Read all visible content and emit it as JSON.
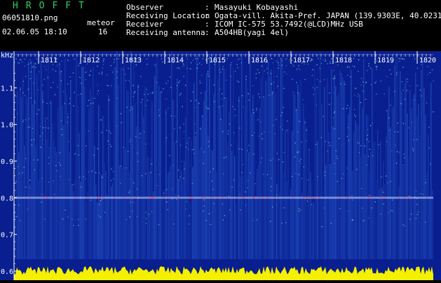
{
  "header": {
    "app_title": "HROFFT",
    "file_name": "06051810.png",
    "datetime": "02.06.05 18:10",
    "meteor_label": "meteor",
    "meteor_count": "16"
  },
  "meta": [
    {
      "key": "Observer",
      "value": "Masayuki Kobayashi"
    },
    {
      "key": "Receiving Location",
      "value": "Ogata-vill. Akita-Pref. JAPAN (139.9303E, 40.0231N)"
    },
    {
      "key": "Receiver",
      "value": "ICOM IC-575 53.7492(@LCD)MHz USB"
    },
    {
      "key": "Receiving antenna",
      "value": "A504HB(yagi 4el)"
    }
  ],
  "meta_colon": ":",
  "spectrogram": {
    "y_unit": "kHz",
    "y_ticks": [
      "1.1",
      "1.0",
      "0.9",
      "0.8",
      "0.7",
      "0.6"
    ],
    "y_tick_values": [
      1.1,
      1.0,
      0.9,
      0.8,
      0.7,
      0.6
    ],
    "y_range": [
      0.575,
      1.2
    ],
    "time_labels": [
      "1811",
      "1812",
      "1813",
      "1814",
      "1815",
      "1816",
      "1817",
      "1818",
      "1819",
      "1820"
    ],
    "carrier_freq_khz": 0.8,
    "colors": {
      "background": "#0a1f8f",
      "streak": "#2a63d6",
      "speckle": "#6fd6c4",
      "carrier": "#ff3a5a",
      "amplitude": "#f4f000",
      "text": "#ffffff"
    }
  }
}
